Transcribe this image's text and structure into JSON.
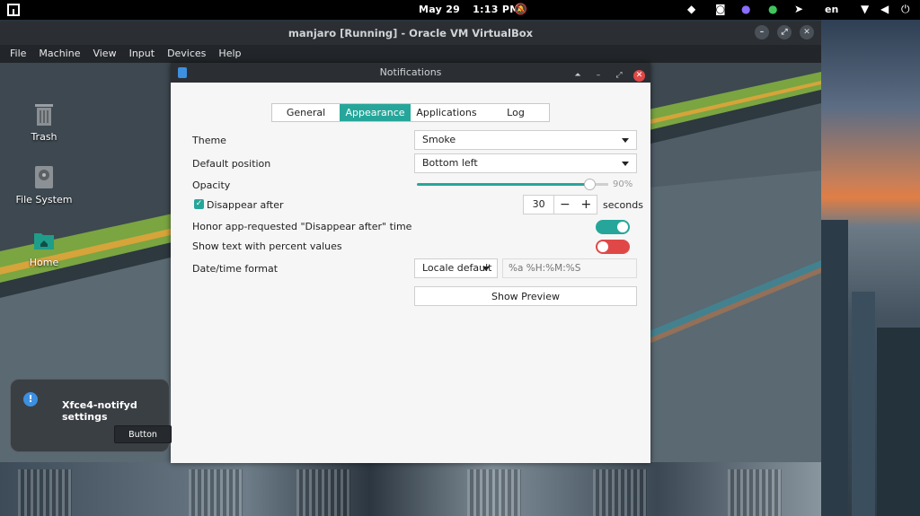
{
  "top_panel": {
    "date": "May 29",
    "time": "1:13 PM",
    "language": "en"
  },
  "vbox": {
    "title": "manjaro [Running] - Oracle VM VirtualBox",
    "menu": [
      "File",
      "Machine",
      "View",
      "Input",
      "Devices",
      "Help"
    ]
  },
  "desktop": {
    "icons": [
      "Trash",
      "File System",
      "Home"
    ]
  },
  "notifications": {
    "title": "Notifications",
    "tabs": [
      "General",
      "Appearance",
      "Applications",
      "Log"
    ],
    "active_tab": "Appearance",
    "theme_label": "Theme",
    "theme_value": "Smoke",
    "position_label": "Default position",
    "position_value": "Bottom left",
    "opacity_label": "Opacity",
    "opacity_value": "90%",
    "opacity_level": 0.9,
    "disappear_label": "Disappear after",
    "disappear_checked": true,
    "disappear_value": "30",
    "disappear_unit": "seconds",
    "honor_label": "Honor app-requested \"Disappear after\" time",
    "honor_on": true,
    "percent_label": "Show text with percent values",
    "percent_on": false,
    "datetime_label": "Date/time format",
    "datetime_value": "Locale default",
    "datetime_placeholder": "%a %H:%M:%S",
    "preview_label": "Show Preview"
  },
  "toast": {
    "summary": "Xfce4-notifyd settings",
    "button": "Button"
  },
  "colors": {
    "accent": "#26a69a",
    "toggle_off": "#e04848"
  }
}
